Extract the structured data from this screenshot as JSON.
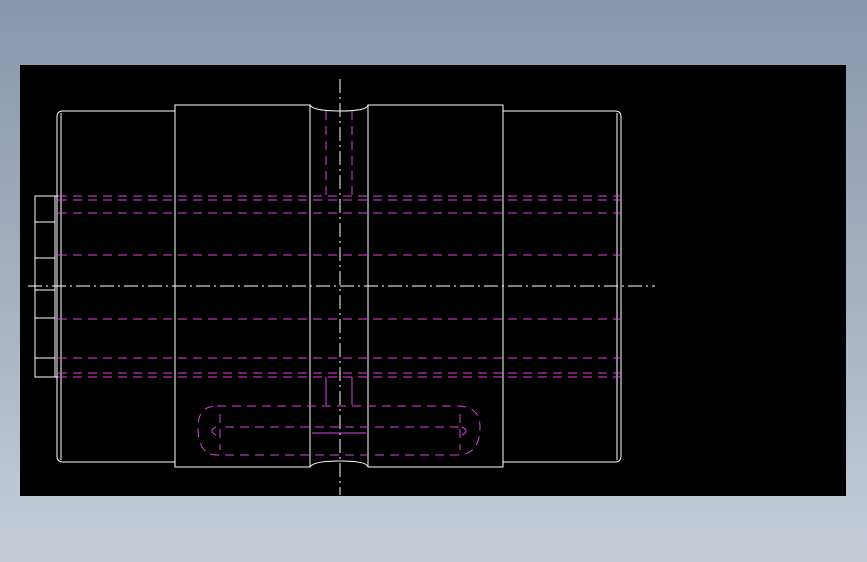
{
  "viewer": {
    "background": "#000000",
    "outer_gradient": [
      "#8797ab",
      "#c6cdd7"
    ]
  },
  "drawing": {
    "subject": "coupling",
    "view": "side view",
    "colors": {
      "outline": "#ffffff",
      "hidden_lines": "#e040e0",
      "center_lines": "#ffffff"
    },
    "line_styles": {
      "outline": "solid",
      "hidden_lines": "dashed",
      "center_lines": "dash-dot"
    }
  }
}
